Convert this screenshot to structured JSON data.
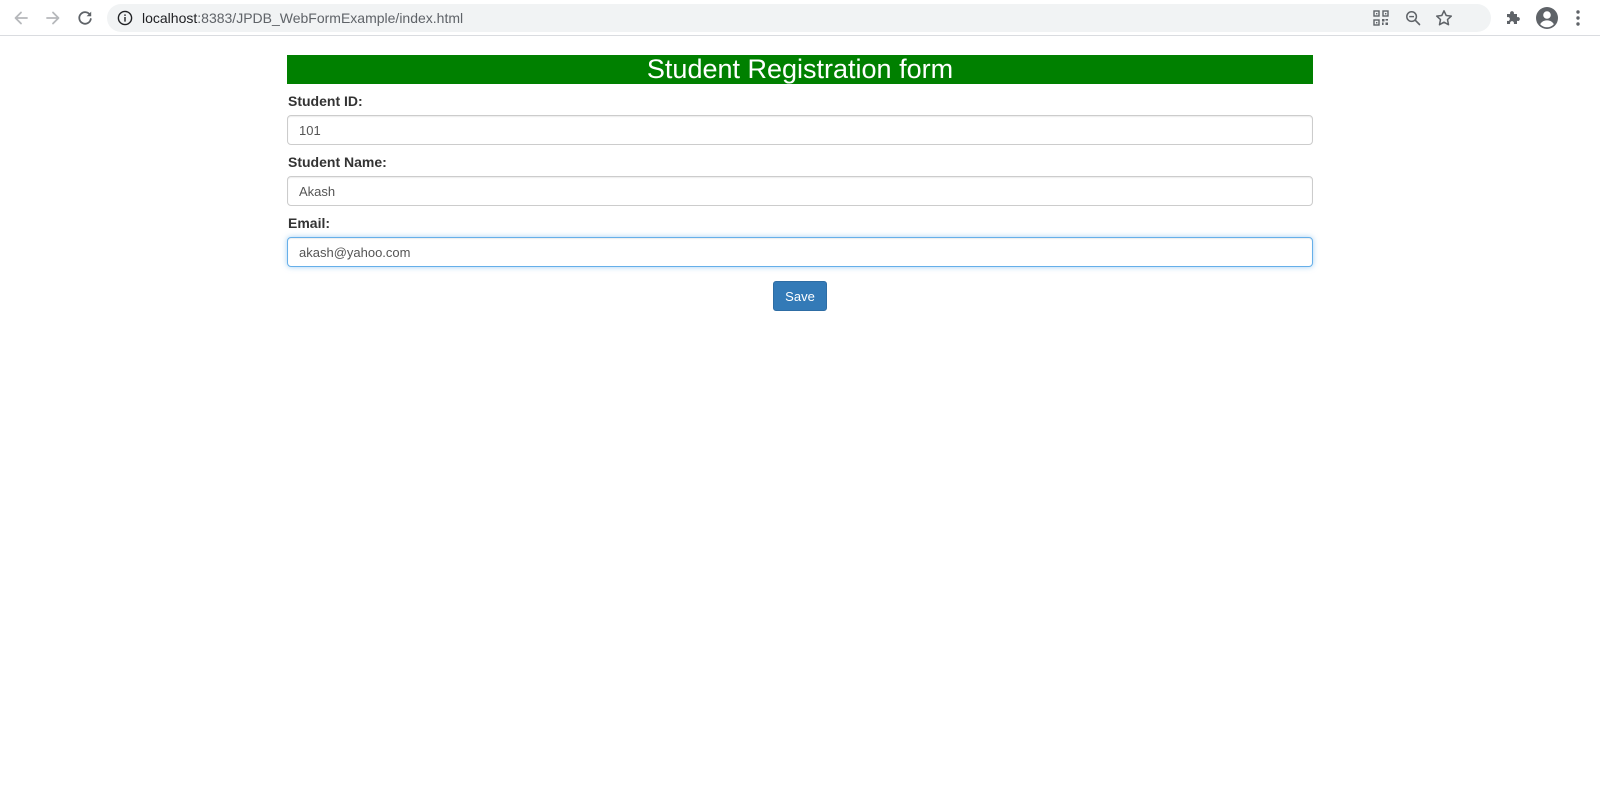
{
  "browser": {
    "url_host": "localhost",
    "url_rest": ":8383/JPDB_WebFormExample/index.html",
    "icons": {
      "back": "arrow-left-icon",
      "forward": "arrow-right-icon",
      "reload": "reload-icon",
      "site_info": "info-icon",
      "qr": "qr-code-icon",
      "zoom": "zoom-out-icon",
      "bookmark": "star-icon",
      "extensions": "puzzle-icon",
      "profile": "account-icon",
      "menu": "kebab-menu-icon"
    }
  },
  "form": {
    "title": "Student Registration form",
    "header_color": "#008000",
    "fields": [
      {
        "label": "Student ID:",
        "value": "101"
      },
      {
        "label": "Student Name:",
        "value": "Akash"
      },
      {
        "label": "Email:",
        "value": "akash@yahoo.com"
      }
    ],
    "save_label": "Save",
    "button_color": "#337ab7"
  }
}
